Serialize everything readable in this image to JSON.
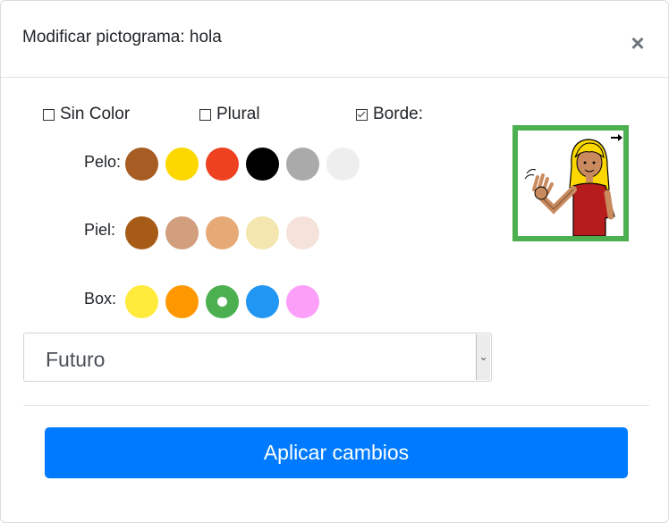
{
  "modal": {
    "title": "Modificar pictograma: hola",
    "close_label": "×"
  },
  "options": [
    {
      "label": "Sin Color",
      "checked": false
    },
    {
      "label": "Plural",
      "checked": false
    },
    {
      "label": "Borde:",
      "checked": true
    }
  ],
  "pelo": {
    "label": "Pelo:",
    "colors": [
      "#a65c22",
      "#fdd800",
      "#ed4120",
      "#000000",
      "#aaaaaa",
      "#eeeeee"
    ]
  },
  "piel": {
    "label": "Piel:",
    "colors": [
      "#a65c17",
      "#d19e7e",
      "#e6aa76",
      "#f3e6ae",
      "#f5e2da"
    ]
  },
  "box": {
    "label": "Box:",
    "colors": [
      "#ffeb3b",
      "#ff9800",
      "#4caf50",
      "#2196f3",
      "#fb9ff9"
    ],
    "selected_index": 2
  },
  "picto": {
    "border_color": "#4caf50"
  },
  "tense_select": {
    "value": "Futuro"
  },
  "apply_button": {
    "label": "Aplicar cambios"
  },
  "colors": {
    "primary": "#007bff"
  }
}
